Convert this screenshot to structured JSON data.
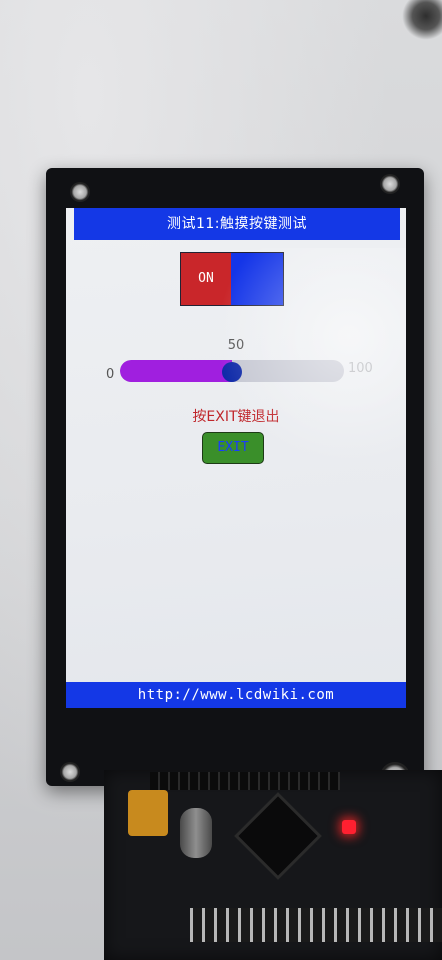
{
  "screen": {
    "title": "测试11:触摸按键测试",
    "footer_url": "http://www.lcdwiki.com",
    "toggle": {
      "label": "ON",
      "state": "on"
    },
    "slider": {
      "value": "50",
      "min_label": "0",
      "max_label": "100",
      "fraction": 0.5
    },
    "exit_hint": "按EXIT键退出",
    "exit_button_label": "EXIT"
  },
  "colors": {
    "title_bar": "#1438e6",
    "toggle_on": "#c9262a",
    "toggle_off": "#1435e8",
    "slider_fill": "#a01fdf",
    "slider_knob": "#0f2aa8",
    "exit_hint": "#c0272c",
    "exit_button": "#3a8f2a",
    "board_led": "#ff2030"
  }
}
